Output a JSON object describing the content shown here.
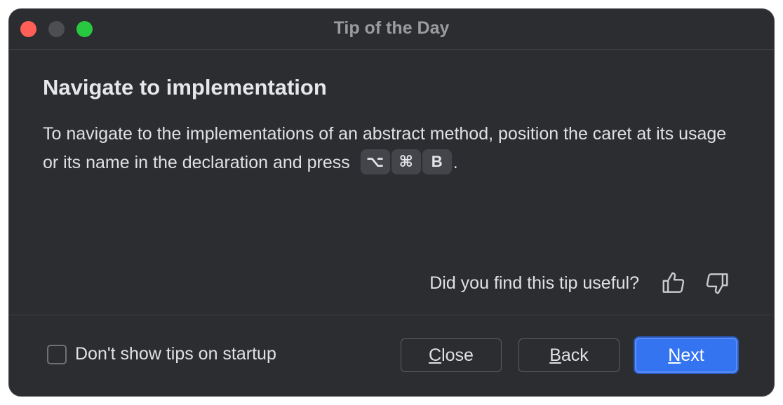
{
  "window": {
    "title": "Tip of the Day"
  },
  "tip": {
    "heading": "Navigate to implementation",
    "text_before": "To navigate to the implementations of an abstract method, position the caret at its usage or its name in the declaration and press",
    "keys": [
      "⌥",
      "⌘",
      "B"
    ],
    "text_after": "."
  },
  "feedback": {
    "question": "Did you find this tip useful?",
    "thumbs_up_icon": "thumbs-up-icon",
    "thumbs_down_icon": "thumbs-down-icon"
  },
  "footer": {
    "checkbox_label": "Don't show tips on startup",
    "checkbox_checked": false,
    "close_mnemonic": "C",
    "close_rest": "lose",
    "back_mnemonic": "B",
    "back_rest": "ack",
    "next_mnemonic": "N",
    "next_rest": "ext"
  },
  "colors": {
    "background": "#2b2d30",
    "accent": "#3574f0",
    "traffic_close": "#ff5f57",
    "traffic_min": "#4c4e52",
    "traffic_max": "#28c840"
  }
}
